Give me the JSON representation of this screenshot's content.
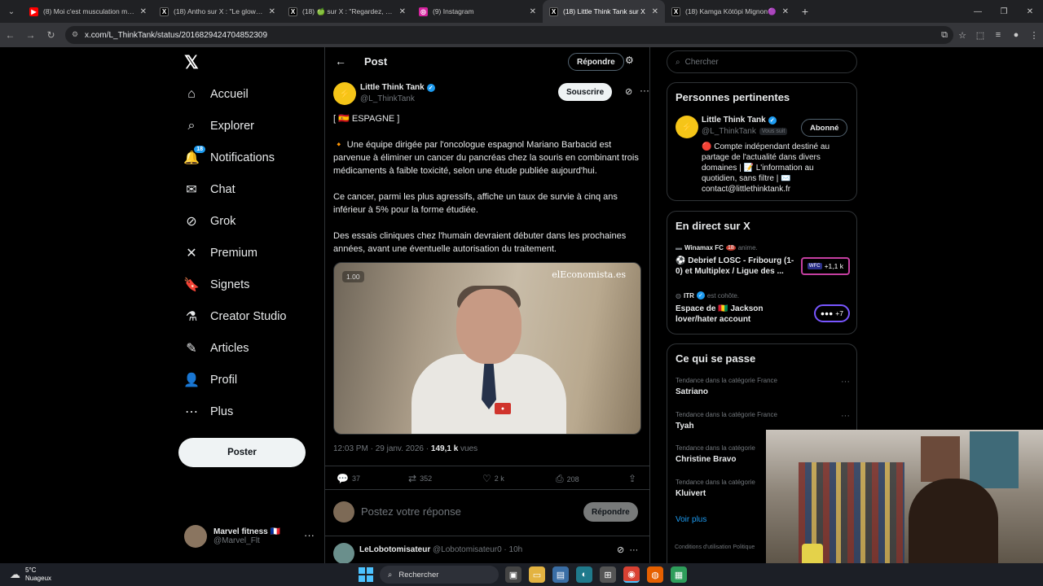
{
  "browser": {
    "tabs": [
      {
        "title": "(8) Moi c'est musculation matin",
        "icon": "youtube-icon",
        "color": "#ff0000",
        "glyph": "▶"
      },
      {
        "title": "(18) Antho sur X : \"Le glow up",
        "icon": "x-icon",
        "color": "#000000",
        "glyph": "X"
      },
      {
        "title": "(18) 🍏 sur X : \"Regardez, dites",
        "icon": "x-icon",
        "color": "#000000",
        "glyph": "X"
      },
      {
        "title": "(9) Instagram",
        "icon": "instagram-icon",
        "color": "#d6249f",
        "glyph": "◎"
      },
      {
        "title": "(18) Little Think Tank sur X",
        "icon": "x-icon",
        "color": "#000000",
        "glyph": "X",
        "active": true
      },
      {
        "title": "(18) Kamga Kötöpi Mignon🟣",
        "icon": "x-icon",
        "color": "#000000",
        "glyph": "X"
      }
    ],
    "url": "x.com/L_ThinkTank/status/2016829424704852309"
  },
  "nav": {
    "items": [
      {
        "label": "Accueil",
        "icon": "home-icon",
        "glyph": "⌂"
      },
      {
        "label": "Explorer",
        "icon": "search-icon",
        "glyph": "⌕"
      },
      {
        "label": "Notifications",
        "icon": "bell-icon",
        "glyph": "🔔",
        "badge": "18"
      },
      {
        "label": "Chat",
        "icon": "mail-icon",
        "glyph": "✉"
      },
      {
        "label": "Grok",
        "icon": "grok-icon",
        "glyph": "⊘"
      },
      {
        "label": "Premium",
        "icon": "x-premium-icon",
        "glyph": "✕"
      },
      {
        "label": "Signets",
        "icon": "bookmark-icon",
        "glyph": "🔖"
      },
      {
        "label": "Creator Studio",
        "icon": "flask-icon",
        "glyph": "⚗"
      },
      {
        "label": "Articles",
        "icon": "article-icon",
        "glyph": "✎"
      },
      {
        "label": "Profil",
        "icon": "user-icon",
        "glyph": "👤"
      },
      {
        "label": "Plus",
        "icon": "more-circle-icon",
        "glyph": "⋯"
      }
    ],
    "post_button": "Poster",
    "account": {
      "name": "Marvel fitness 🇫🇷",
      "handle": "@Marvel_Flt"
    }
  },
  "main": {
    "title": "Post",
    "reply_top": "Répondre",
    "author": {
      "name": "Little Think Tank",
      "handle": "@L_ThinkTank",
      "subscribe": "Souscrire"
    },
    "paragraphs": [
      "[ 🇪🇸 ESPAGNE ]",
      "🔸 Une équipe dirigée par l'oncologue espagnol Mariano Barbacid est parvenue à éliminer un cancer du pancréas chez la souris en combinant trois médicaments à faible toxicité, selon une étude publiée aujourd'hui.",
      "Ce cancer, parmi les plus agressifs, affiche un taux de survie à cinq ans inférieur à 5% pour la forme étudiée.",
      "Des essais cliniques chez l'humain devraient débuter dans les prochaines années, avant une éventuelle autorisation du traitement."
    ],
    "video": {
      "speed": "1.00",
      "watermark": "elEconomista.es"
    },
    "timestamp": "12:03 PM · 29 janv. 2026 · ",
    "views_count": "149,1 k",
    "views_label": " vues",
    "actions": {
      "replies": "37",
      "reposts": "352",
      "likes": "2 k",
      "bookmarks": "208"
    },
    "reply_placeholder": "Postez votre réponse",
    "reply_button": "Répondre",
    "next_reply": {
      "name": "LeLobotomisateur",
      "handle": "@Lobotomisateur0 · 10h"
    }
  },
  "right": {
    "search_placeholder": "Chercher",
    "relevant": {
      "title": "Personnes pertinentes",
      "name": "Little Think Tank",
      "handle": "@L_ThinkTank",
      "follows_you": "Vous suit",
      "button": "Abonné",
      "bio": "🔴 Compte indépendant destiné au partage de l'actualité dans divers domaines | 📝 L'information au quotidien, sans filtre | ✉️ contact@littlethinktank.fr"
    },
    "live": {
      "title": "En direct sur X",
      "items": [
        {
          "host": "Winamax FC",
          "host_badge": "18",
          "suffix": "anime.",
          "title": "⚽ Debrief LOSC - Fribourg (1-0) et Multiplex / Ligue des ...",
          "tag": "+1,1 k"
        },
        {
          "host": "ITR",
          "suffix": "est cohôte.",
          "title": "Espace de 🇬🇳 Jackson lover/hater account",
          "tag": "+7"
        }
      ]
    },
    "trends": {
      "title": "Ce qui se passe",
      "items": [
        {
          "category": "Tendance dans la catégorie France",
          "name": "Satriano"
        },
        {
          "category": "Tendance dans la catégorie France",
          "name": "Tyah"
        },
        {
          "category": "Tendance dans la catégorie",
          "name": "Christine Bravo"
        },
        {
          "category": "Tendance dans la catégorie",
          "name": "Kluivert"
        }
      ],
      "see_more": "Voir plus"
    },
    "footer": "Conditions d'utilisation   Politique"
  },
  "taskbar": {
    "temp": "5°C",
    "condition": "Nuageux",
    "search": "Rechercher"
  }
}
